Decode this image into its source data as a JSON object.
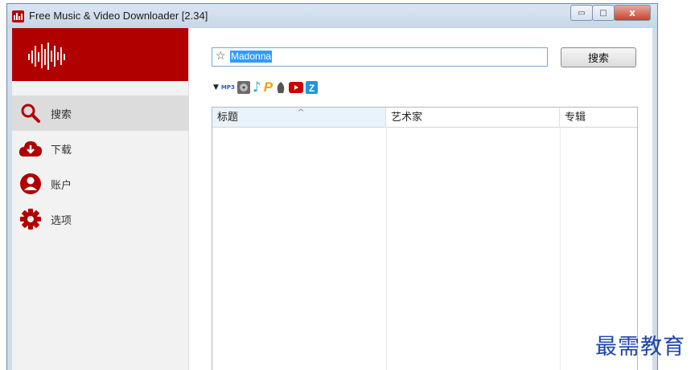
{
  "window": {
    "title": "Free Music & Video Downloader [2.34]",
    "buttons": {
      "minimize": "▭",
      "maximize": "□",
      "close": "x"
    }
  },
  "sidebar": {
    "items": [
      {
        "label": "搜索",
        "icon": "search-icon",
        "active": true
      },
      {
        "label": "下载",
        "icon": "cloud-download-icon",
        "active": false
      },
      {
        "label": "账户",
        "icon": "user-icon",
        "active": false
      },
      {
        "label": "选项",
        "icon": "gear-icon",
        "active": false
      }
    ]
  },
  "search": {
    "value": "Madonna",
    "button_label": "搜索"
  },
  "sources": [
    "mp3-icon",
    "vinyl-icon",
    "music-note-icon",
    "pandora-icon",
    "soundcloud-icon",
    "youtube-icon",
    "zing-icon"
  ],
  "table": {
    "columns": [
      "标题",
      "艺术家",
      "专辑"
    ],
    "sorted_column": "标题",
    "rows": []
  },
  "watermark": "最需教育",
  "colors": {
    "brand": "#b10000",
    "selection": "#3399ff"
  }
}
